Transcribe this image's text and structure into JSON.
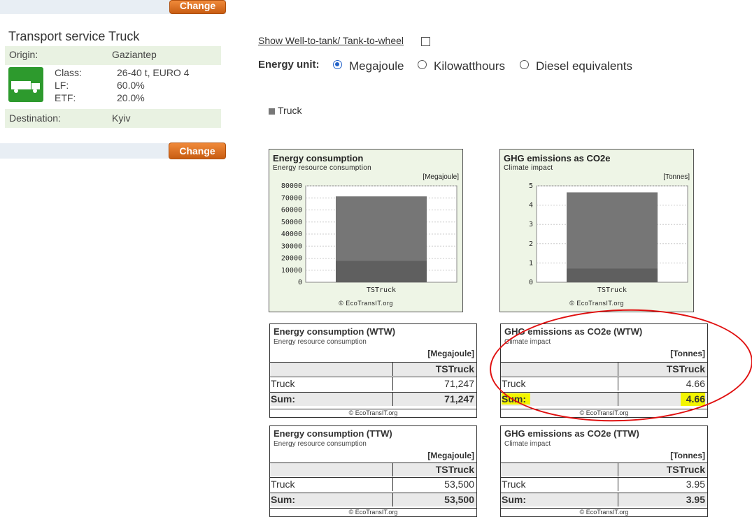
{
  "left_panel": {
    "top_button": "Change",
    "title": "Transport service Truck",
    "origin_label": "Origin:",
    "origin_value": "Gaziantep",
    "class_label": "Class:",
    "class_value": "26-40 t, EURO 4",
    "lf_label": "LF:",
    "lf_value": "60.0%",
    "etf_label": "ETF:",
    "etf_value": "20.0%",
    "destination_label": "Destination:",
    "destination_value": "Kyiv",
    "bottom_button": "Change",
    "icon": "truck-icon"
  },
  "controls": {
    "wtw_link": "Show Well-to-tank/ Tank-to-wheel",
    "energy_unit_label": "Energy unit:",
    "options": [
      "Megajoule",
      "Kilowatthours",
      "Diesel equivalents"
    ],
    "selected": "Megajoule"
  },
  "legend": {
    "label": "Truck",
    "color": "#777777"
  },
  "chart_data": [
    {
      "type": "bar",
      "title": "Energy consumption",
      "subtitle": "Energy resource consumption",
      "unit": "[Megajoule]",
      "categories": [
        "TSTruck"
      ],
      "series": [
        {
          "name": "TTW",
          "values": [
            53500
          ]
        },
        {
          "name": "WTW",
          "values": [
            71247
          ]
        }
      ],
      "ylim": [
        0,
        80000
      ],
      "yticks": [
        "80000",
        "70000",
        "60000",
        "50000",
        "40000",
        "30000",
        "20000",
        "10000",
        "0"
      ],
      "copyright": "© EcoTransIT.org",
      "grid": true
    },
    {
      "type": "bar",
      "title": "GHG emissions as CO2e",
      "subtitle": "Climate impact",
      "unit": "[Tonnes]",
      "categories": [
        "TSTruck"
      ],
      "series": [
        {
          "name": "TTW",
          "values": [
            3.95
          ]
        },
        {
          "name": "WTW",
          "values": [
            4.66
          ]
        }
      ],
      "ylim": [
        0,
        5
      ],
      "yticks": [
        "5",
        "4",
        "3",
        "2",
        "1",
        "0"
      ],
      "copyright": "© EcoTransIT.org",
      "grid": true
    }
  ],
  "tables": {
    "energy_wtw": {
      "title": "Energy consumption (WTW)",
      "subtitle": "Energy resource consumption",
      "unit": "[Megajoule]",
      "column": "TSTruck",
      "row_label": "Truck",
      "row_value": "71,247",
      "sum_label": "Sum:",
      "sum_value": "71,247",
      "copyright": "© EcoTransIT.org"
    },
    "ghg_wtw": {
      "title": "GHG emissions as CO2e (WTW)",
      "subtitle": "Climate impact",
      "unit": "[Tonnes]",
      "column": "TSTruck",
      "row_label": "Truck",
      "row_value": "4.66",
      "sum_label": "Sum:",
      "sum_value": "4.66",
      "copyright": "© EcoTransIT.org"
    },
    "energy_ttw": {
      "title": "Energy consumption (TTW)",
      "subtitle": "Energy resource consumption",
      "unit": "[Megajoule]",
      "column": "TSTruck",
      "row_label": "Truck",
      "row_value": "53,500",
      "sum_label": "Sum:",
      "sum_value": "53,500",
      "copyright": "© EcoTransIT.org"
    },
    "ghg_ttw": {
      "title": "GHG emissions as CO2e (TTW)",
      "subtitle": "Climate impact",
      "unit": "[Tonnes]",
      "column": "TSTruck",
      "row_label": "Truck",
      "row_value": "3.95",
      "sum_label": "Sum:",
      "sum_value": "3.95",
      "copyright": "© EcoTransIT.org"
    }
  },
  "colors": {
    "accent_button": "#d86b1c",
    "panel_green": "#e9f2e2",
    "highlight": "#f3f500",
    "annotation_red": "#e01010",
    "radio_blue": "#2161c8"
  }
}
